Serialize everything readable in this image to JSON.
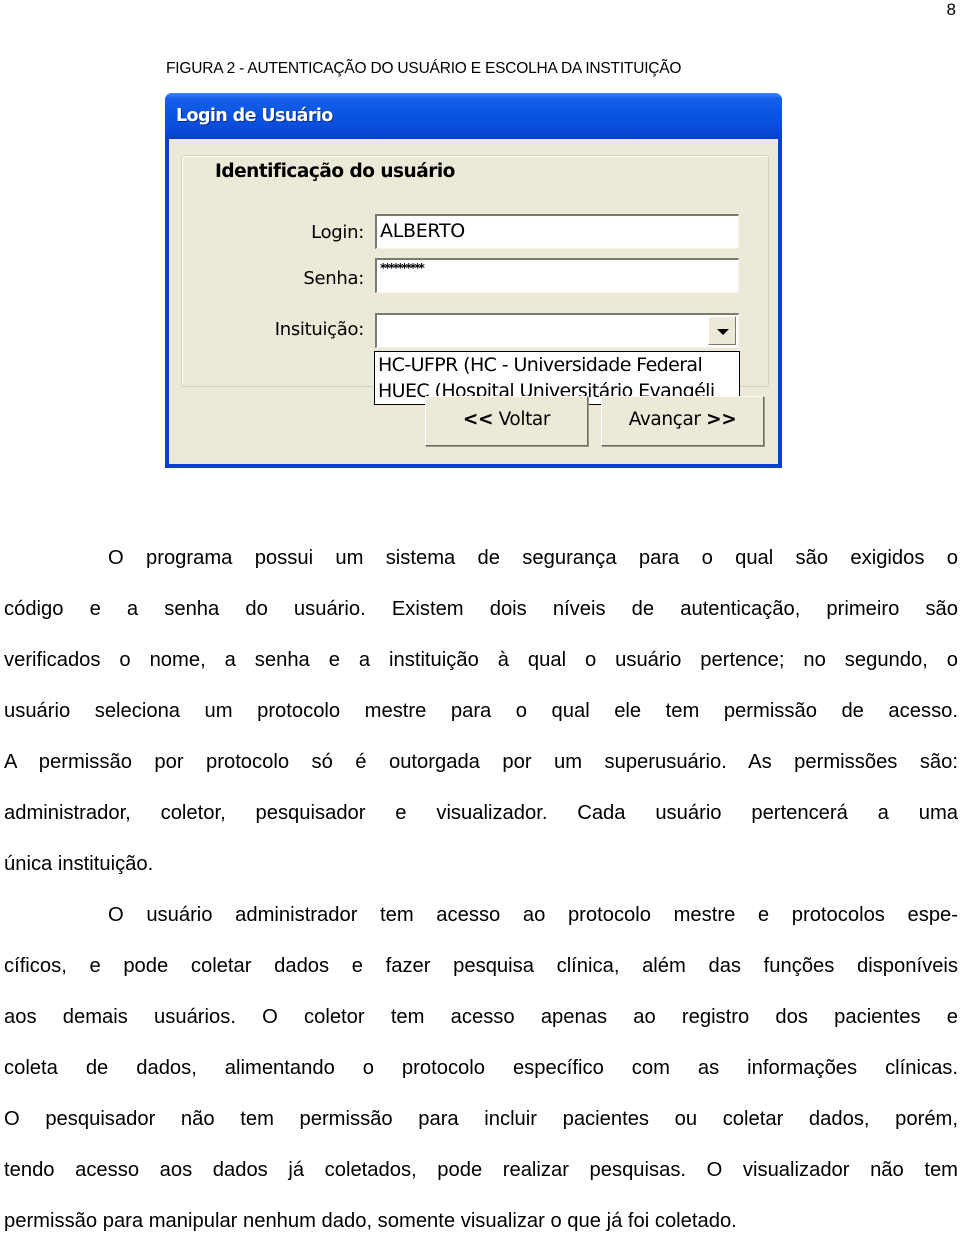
{
  "page": {
    "number": "8",
    "figure_caption": "FIGURA 2 - AUTENTICAÇÃO DO USUÁRIO E ESCOLHA DA INSTITUIÇÃO"
  },
  "window": {
    "title": "Login de Usuário",
    "colors": {
      "titlebar": "#0a55e4",
      "client": "#ece9d8"
    },
    "group": {
      "legend": "Identificação do usuário",
      "login": {
        "label": "Login:",
        "value": "ALBERTO"
      },
      "senha": {
        "label": "Senha:",
        "value": "**********"
      },
      "instituicao": {
        "label": "Insituição:",
        "value": "",
        "dropdown_icon": "chevron-down-icon",
        "options": [
          "HC-UFPR (HC - Universidade Federal",
          "HUEC (Hospital Universitário Evangéli"
        ]
      }
    },
    "buttons": {
      "voltar": {
        "arrows": "<<",
        "label": "Voltar"
      },
      "avancar": {
        "label": "Avançar",
        "arrows": ">>"
      }
    }
  },
  "body": {
    "paragraphs": [
      {
        "lines": [
          "O programa possui um sistema de segurança para o qual são exigidos o",
          "código e a senha do usuário. Existem dois níveis de autenticação, primeiro são",
          "verificados o nome, a senha e a instituição à qual o usuário pertence; no segundo, o",
          "usuário seleciona um protocolo mestre para o qual ele tem permissão de acesso.",
          "A permissão por protocolo só é outorgada por um superusuário. As permissões são:",
          "administrador, coletor, pesquisador e visualizador. Cada usuário pertencerá a uma",
          "única instituição."
        ]
      },
      {
        "lines": [
          "O usuário administrador tem acesso ao protocolo mestre e protocolos espe-",
          "cíficos, e pode coletar dados e fazer pesquisa clínica, além das funções disponíveis",
          "aos demais usuários. O coletor tem acesso apenas ao registro dos pacientes e",
          "coleta de dados, alimentando o protocolo específico com as informações clínicas.",
          "O pesquisador não tem permissão para incluir pacientes ou coletar dados, porém,",
          "tendo acesso aos dados já coletados, pode realizar pesquisas. O visualizador não tem",
          "permissão para manipular nenhum dado, somente visualizar o que já foi coletado."
        ]
      }
    ]
  }
}
